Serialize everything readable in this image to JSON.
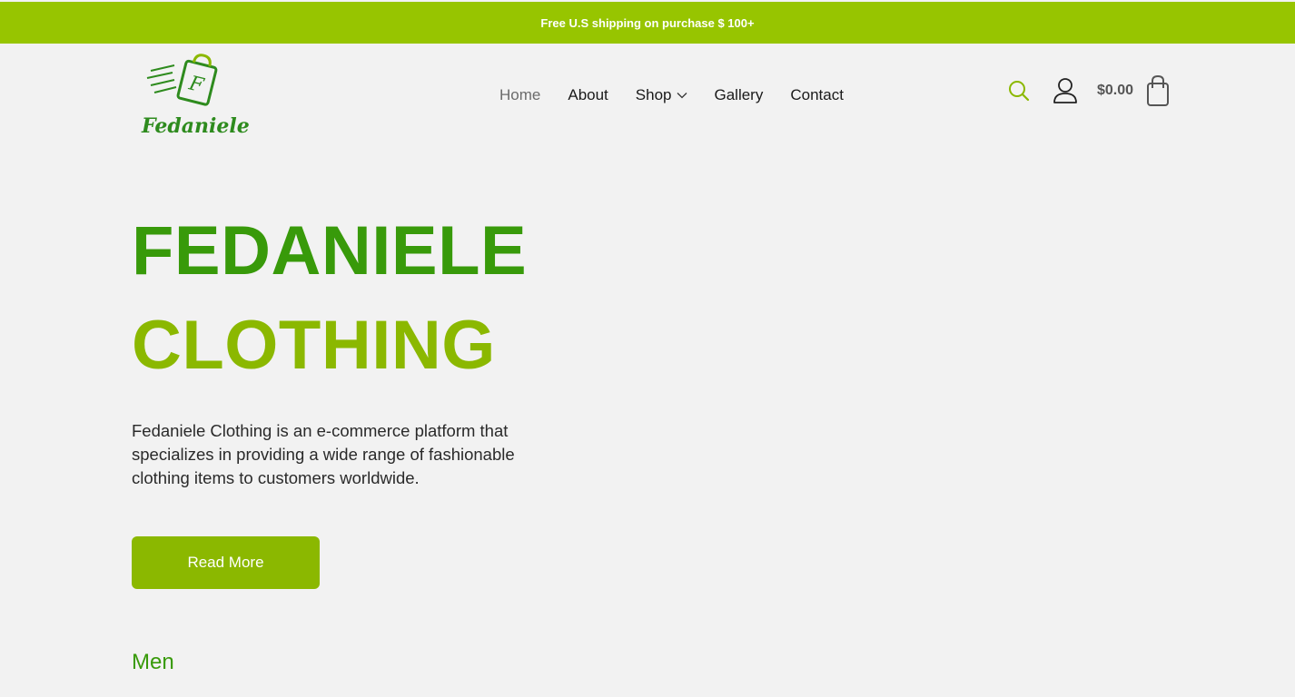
{
  "topbar": {
    "text": "Free U.S shipping on purchase $ 100+"
  },
  "logo": {
    "text": "Fedaniele"
  },
  "nav": {
    "items": [
      {
        "label": "Home",
        "active": true
      },
      {
        "label": "About"
      },
      {
        "label": "Shop",
        "has_dropdown": true
      },
      {
        "label": "Gallery"
      },
      {
        "label": "Contact"
      }
    ]
  },
  "header": {
    "cart_total": "$0.00",
    "icons": [
      "search-icon",
      "user-icon",
      "shopping-bag-icon"
    ]
  },
  "hero": {
    "title_line1": "FEDANIELE",
    "title_line2": "CLOTHING",
    "description": "Fedaniele Clothing is an e-commerce platform that specializes in providing a wide range of fashionable clothing items to customers worldwide.",
    "button_label": "Read More"
  },
  "sections": {
    "men_label": "Men"
  },
  "colors": {
    "accent": "#97c500",
    "title_green": "#389a0a",
    "title_lime": "#8bb800",
    "background": "#f2f2f2"
  }
}
